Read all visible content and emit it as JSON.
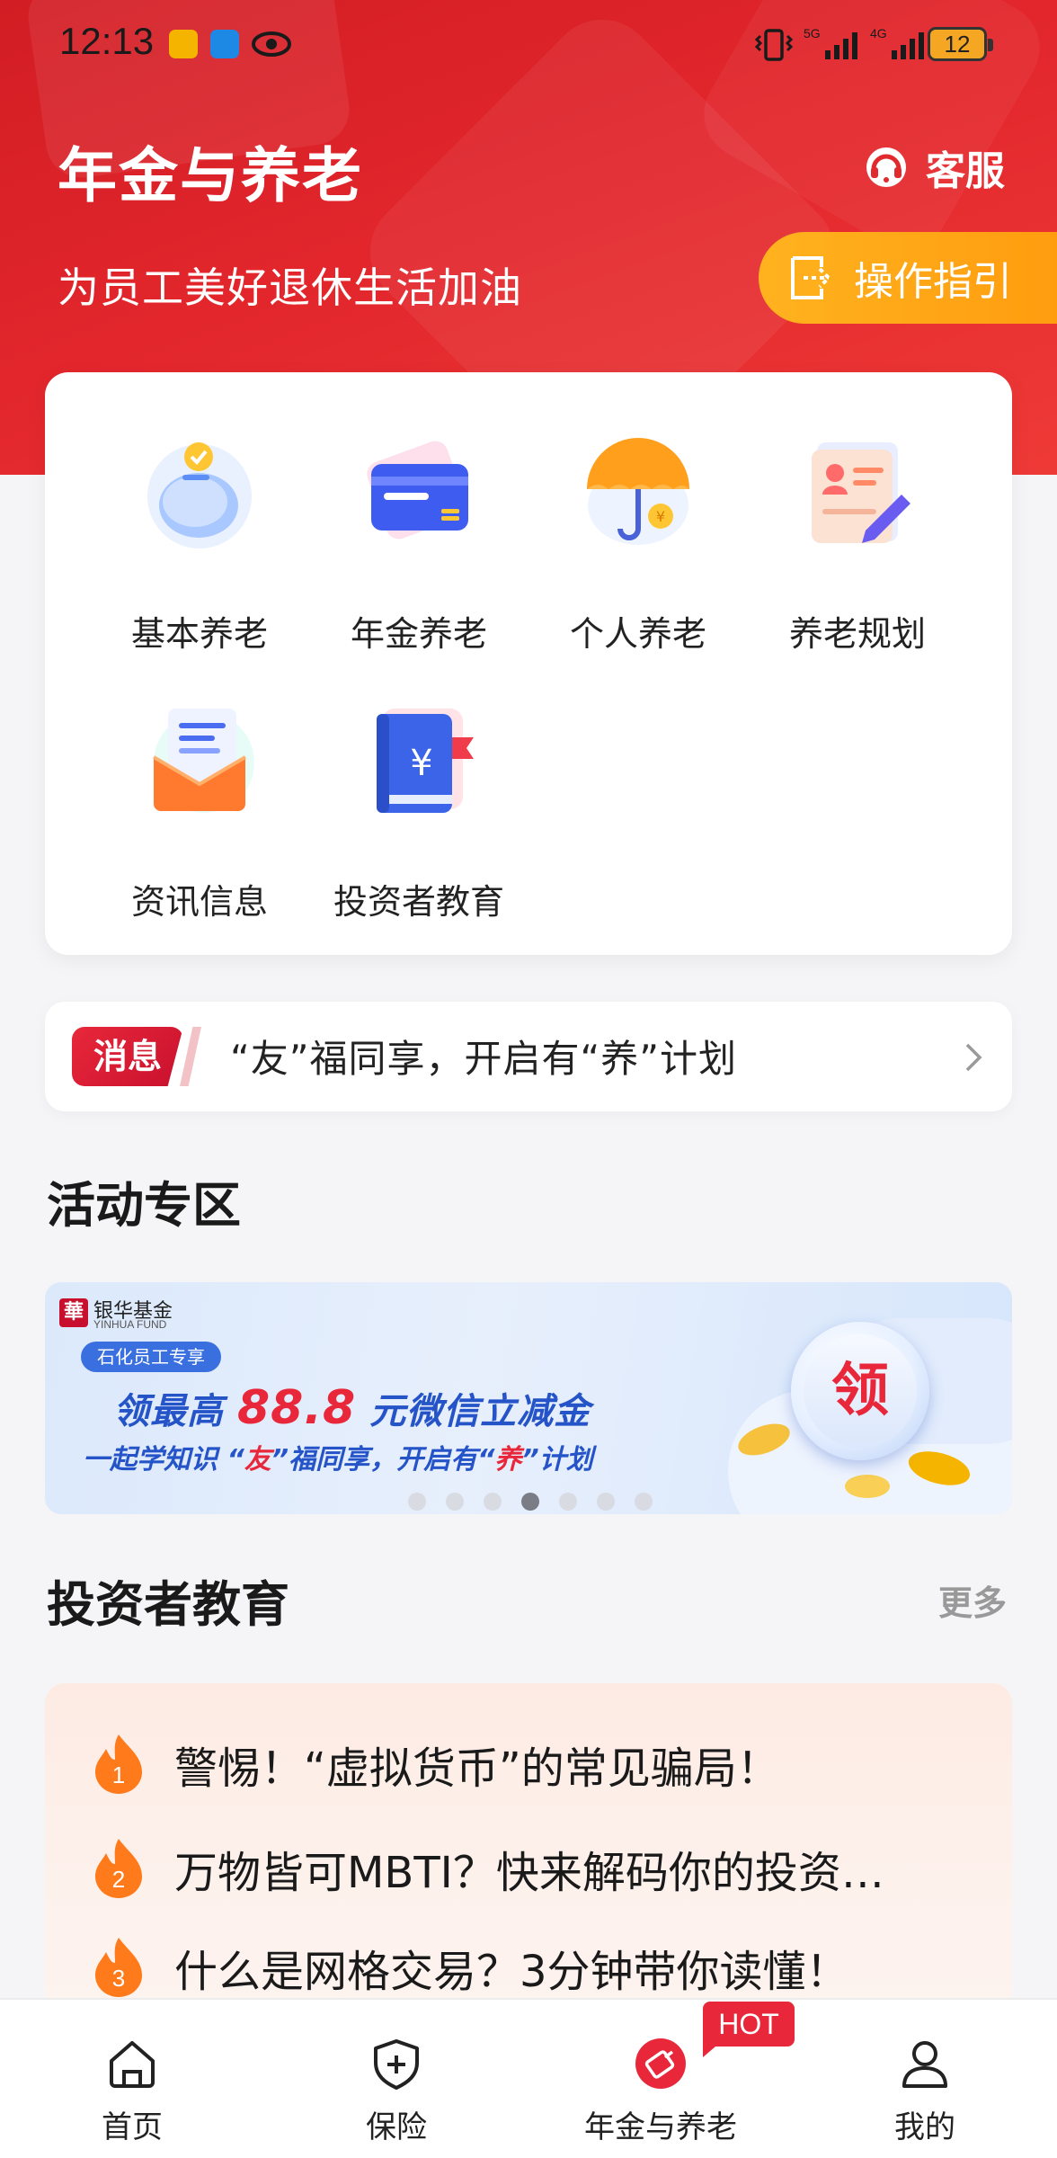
{
  "status_bar": {
    "time": "12:13",
    "battery": "12",
    "network_1": "5G",
    "network_2": "4G",
    "icons": [
      "app-notification-icon",
      "message-icon",
      "eye-icon",
      "vibrate-icon",
      "signal-icon",
      "battery-icon"
    ]
  },
  "header": {
    "title": "年金与养老",
    "subtitle": "为员工美好退休生活加油",
    "service_label": "客服",
    "guide_label": "操作指引",
    "bg_color": "#e02a2e",
    "guide_color": "#ffa716"
  },
  "grid": {
    "items": [
      {
        "label": "基本养老",
        "icon": "piggy-bank-icon"
      },
      {
        "label": "年金养老",
        "icon": "wallet-card-icon"
      },
      {
        "label": "个人养老",
        "icon": "umbrella-icon"
      },
      {
        "label": "养老规划",
        "icon": "planning-document-icon"
      },
      {
        "label": "资讯信息",
        "icon": "news-envelope-icon"
      },
      {
        "label": "投资者教育",
        "icon": "education-book-icon"
      }
    ]
  },
  "message": {
    "tag": "消息",
    "text": "“友”福同享，开启有“养”计划"
  },
  "activity": {
    "title": "活动专区",
    "banner": {
      "logo_cn": "银华基金",
      "logo_en": "YINHUA FUND",
      "logo_mark": "華",
      "badge": "石化员工专享",
      "line1_prefix": "领最高",
      "line1_amount": "88.8",
      "line1_suffix": "元微信立减金",
      "line2_a": "一起学知识 “",
      "line2_b": "友",
      "line2_c": "”福同享，开启有“",
      "line2_d": "养",
      "line2_e": "”计划",
      "coin_label": "领"
    },
    "carousel_total": 7,
    "carousel_active": 4
  },
  "education": {
    "title": "投资者教育",
    "more_label": "更多",
    "items": [
      {
        "rank": "1",
        "text": "警惕！“虚拟货币”的常见骗局！"
      },
      {
        "rank": "2",
        "text": "万物皆可MBTI？快来解码你的投资…"
      },
      {
        "rank": "3",
        "text": "什么是网格交易？3分钟带你读懂！"
      }
    ]
  },
  "bottom_nav": {
    "items": [
      {
        "label": "首页",
        "icon": "home-icon"
      },
      {
        "label": "保险",
        "icon": "shield-plus-icon"
      },
      {
        "label": "年金与养老",
        "icon": "pension-icon",
        "active": true
      },
      {
        "label": "我的",
        "icon": "user-icon"
      }
    ],
    "hot_badge": "HOT"
  }
}
